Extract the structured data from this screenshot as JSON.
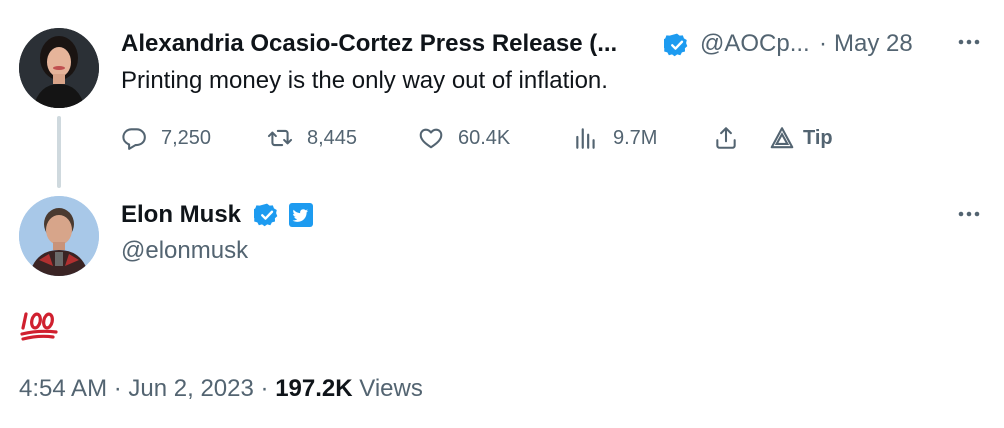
{
  "quoted_tweet": {
    "display_name": "Alexandria Ocasio-Cortez Press Release (...",
    "handle": "@AOCp...",
    "separator": "·",
    "date": "May 28",
    "text": "Printing money is the only way out of inflation.",
    "more_icon": "more-horizontal-icon",
    "actions": {
      "replies": "7,250",
      "retweets": "8,445",
      "likes": "60.4K",
      "views": "9.7M",
      "tip": "Tip"
    }
  },
  "main_tweet": {
    "display_name": "Elon Musk",
    "handle": "@elonmusk",
    "content_emoji": "💯",
    "time": "4:54 AM",
    "sep1": "·",
    "date": "Jun 2, 2023",
    "sep2": "·",
    "view_count": "197.2K",
    "views_label": "Views"
  },
  "colors": {
    "verified_blue": "#1d9bf0",
    "muted_text": "#536471",
    "primary_text": "#0f1419",
    "hundred_red": "#d0202f"
  }
}
